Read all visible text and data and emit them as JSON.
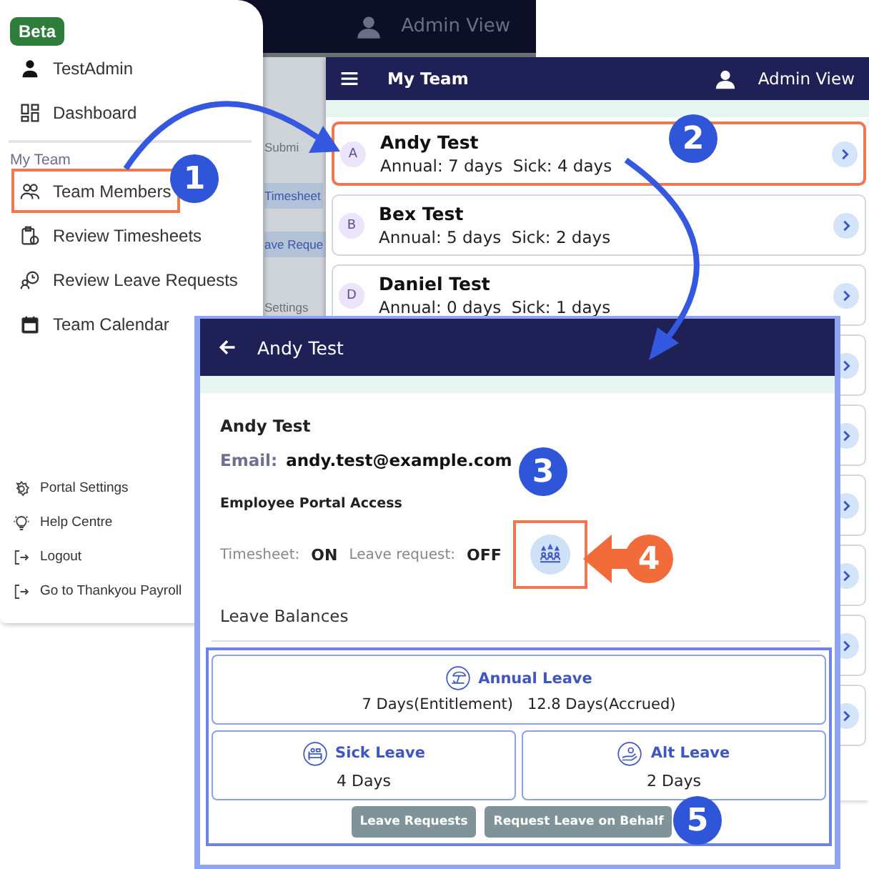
{
  "background_screen": {
    "admin_label": "Admin View",
    "items": [
      {
        "text": "Submi",
        "kind": "label"
      },
      {
        "text": "Timesheet",
        "kind": "button"
      },
      {
        "text": "ave Reque",
        "kind": "button"
      },
      {
        "text": "Settings",
        "kind": "label"
      }
    ]
  },
  "drawer": {
    "badge": "Beta",
    "items": [
      {
        "label": "TestAdmin",
        "highlighted": false
      },
      {
        "label": "Dashboard",
        "highlighted": false
      }
    ],
    "section": "My Team",
    "team_items": [
      {
        "label": "Team Members",
        "highlighted": true
      },
      {
        "label": "Review Timesheets",
        "highlighted": false
      },
      {
        "label": "Review Leave Requests",
        "highlighted": false
      },
      {
        "label": "Team Calendar",
        "highlighted": false
      }
    ],
    "footer_items": [
      {
        "label": "Portal Settings"
      },
      {
        "label": "Help Centre"
      },
      {
        "label": "Logout"
      },
      {
        "label": "Go to Thankyou Payroll"
      }
    ]
  },
  "team_list": {
    "title": "My Team",
    "admin_label": "Admin View",
    "rows": [
      {
        "initial": "A",
        "name": "Andy Test",
        "summary": "Annual: 7 days  Sick: 4 days",
        "highlighted": true
      },
      {
        "initial": "B",
        "name": "Bex Test",
        "summary": "Annual: 5 days  Sick: 2 days",
        "highlighted": false
      },
      {
        "initial": "D",
        "name": "Daniel Test",
        "summary": "Annual: 0 days  Sick: 1 days",
        "highlighted": false
      }
    ],
    "covered_rows": [
      {
        "kind": "row"
      },
      {
        "kind": "row"
      },
      {
        "kind": "row"
      },
      {
        "kind": "row"
      },
      {
        "kind": "row"
      },
      {
        "kind": "row"
      }
    ]
  },
  "detail": {
    "title": "Andy Test",
    "name": "Andy Test",
    "email_label": "Email:",
    "email": "andy.test@example.com",
    "access_heading": "Employee Portal Access",
    "access": [
      {
        "label": "Timesheet:",
        "value": "ON"
      },
      {
        "label": "Leave request:",
        "value": "OFF"
      }
    ],
    "leave_button_highlighted": true,
    "balances_heading": "Leave Balances",
    "balances": [
      {
        "kind": "wide",
        "title": "Annual Leave",
        "values": [
          "7 Days(Entitlement)",
          "12.8 Days(Accrued)"
        ]
      },
      {
        "kind": "half",
        "title": "Sick Leave",
        "values": [
          "4 Days"
        ]
      },
      {
        "kind": "half",
        "title": "Alt Leave",
        "values": [
          "2 Days"
        ]
      }
    ],
    "buttons": [
      "Leave Requests",
      "Request Leave on Behalf"
    ]
  },
  "callouts": [
    {
      "number": "1"
    },
    {
      "number": "2"
    },
    {
      "number": "3"
    },
    {
      "number": "4"
    },
    {
      "number": "5"
    }
  ]
}
